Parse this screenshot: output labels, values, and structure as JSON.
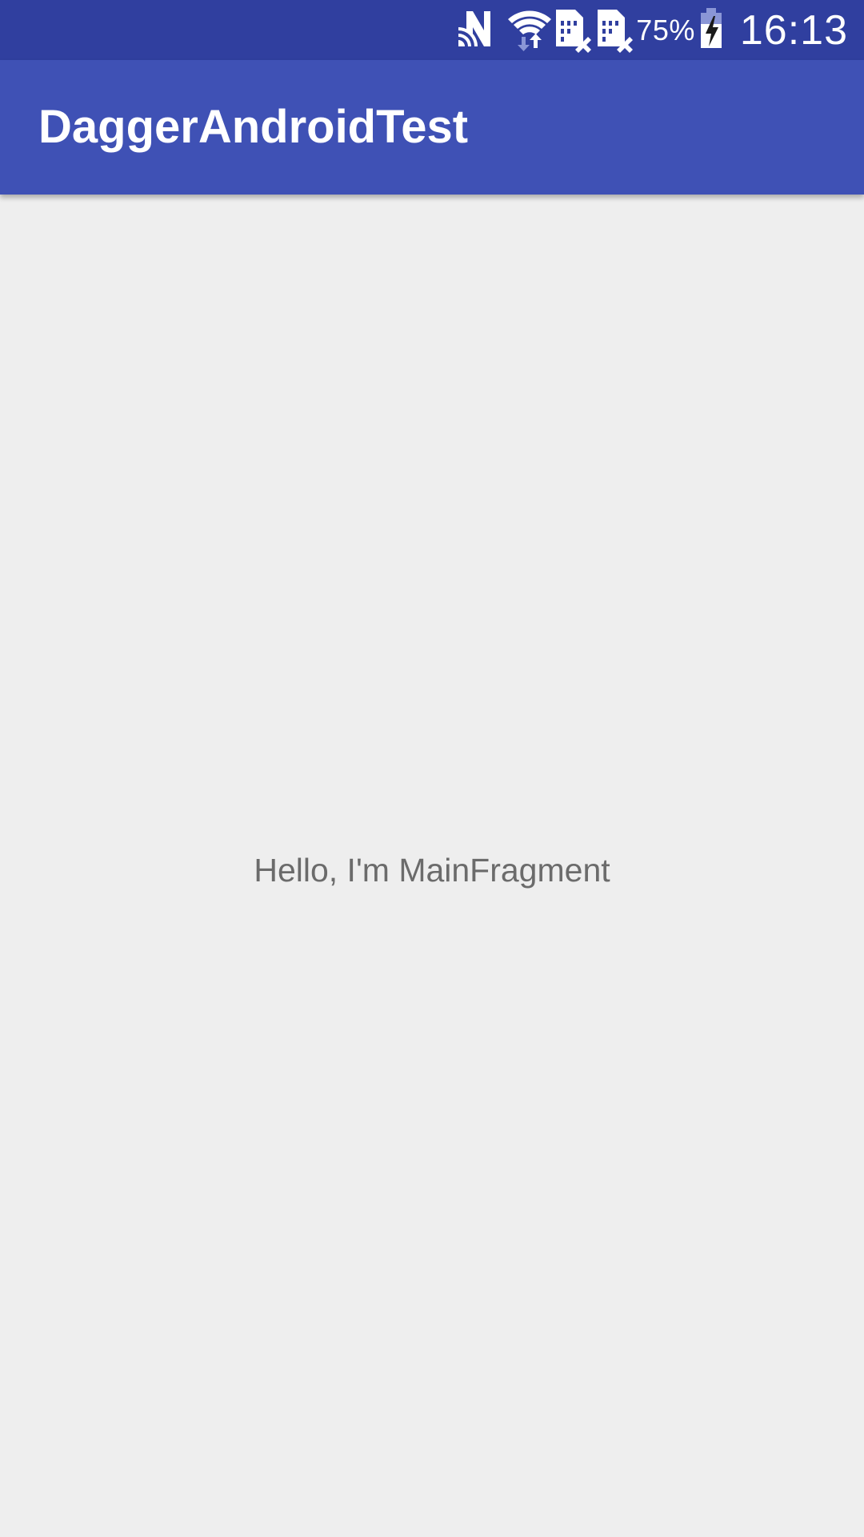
{
  "status_bar": {
    "icons": [
      "nfc-icon",
      "wifi-icon",
      "sim-no-signal-icon",
      "sim-no-signal-icon",
      "battery-charging-icon"
    ],
    "battery_percent": "75%",
    "time": "16:13"
  },
  "app_bar": {
    "title": "DaggerAndroidTest"
  },
  "main": {
    "fragment_text": "Hello, I'm MainFragment"
  },
  "colors": {
    "status_bar": "#303f9f",
    "app_bar": "#3f51b5",
    "background": "#eeeeee",
    "body_text": "#6b6b6b"
  }
}
